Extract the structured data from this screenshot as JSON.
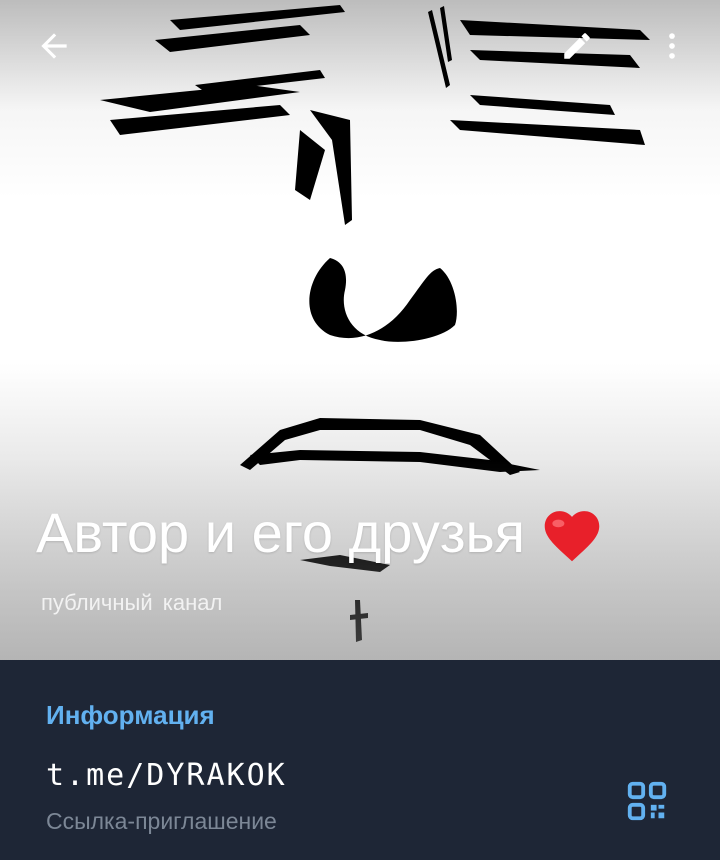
{
  "channel": {
    "title": "Автор и его друзья",
    "title_emoji": "❤️",
    "subtitle": "публичный канал"
  },
  "toolbar": {
    "back_icon": "arrow-left-icon",
    "edit_icon": "pencil-icon",
    "more_icon": "more-vertical-icon"
  },
  "info": {
    "section_title": "Информация",
    "link": "t.me/DYRAKOK",
    "link_caption": "Ссылка-приглашение",
    "qr_icon": "qr-code-icon"
  },
  "colors": {
    "accent": "#62b1f0",
    "panel": "#1e2636",
    "caption": "#7c8796"
  }
}
